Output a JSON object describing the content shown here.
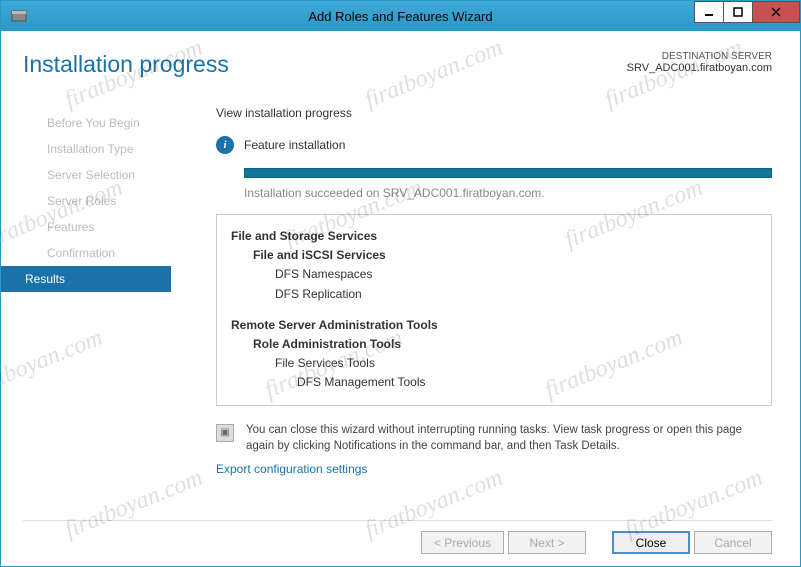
{
  "titlebar": {
    "title": "Add Roles and Features Wizard"
  },
  "header": {
    "page_title": "Installation progress",
    "dest_label": "DESTINATION SERVER",
    "dest_server": "SRV_ADC001.firatboyan.com"
  },
  "steps": {
    "items": [
      "Before You Begin",
      "Installation Type",
      "Server Selection",
      "Server Roles",
      "Features",
      "Confirmation",
      "Results"
    ],
    "active_index": 6
  },
  "main": {
    "view_label": "View installation progress",
    "feature_label": "Feature installation",
    "success_text": "Installation succeeded on SRV_ADC001.firatboyan.com.",
    "results": {
      "group1_l1": "File and Storage Services",
      "group1_l2": "File and iSCSI Services",
      "group1_l3a": "DFS Namespaces",
      "group1_l3b": "DFS Replication",
      "group2_l1": "Remote Server Administration Tools",
      "group2_l2": "Role Administration Tools",
      "group2_l3": "File Services Tools",
      "group2_l4": "DFS Management Tools"
    },
    "hint": "You can close this wizard without interrupting running tasks. View task progress or open this page again by clicking Notifications in the command bar, and then Task Details.",
    "export_link": "Export configuration settings"
  },
  "footer": {
    "previous": "< Previous",
    "next": "Next >",
    "close": "Close",
    "cancel": "Cancel"
  },
  "watermark": "firatboyan.com"
}
